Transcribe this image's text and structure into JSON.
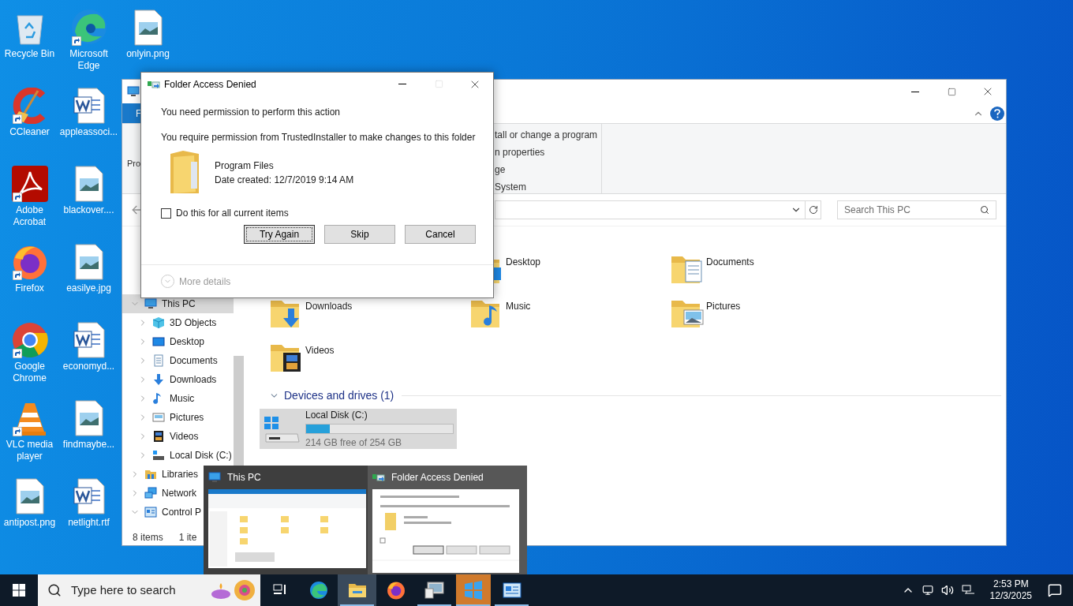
{
  "desktop": {
    "icons": [
      {
        "label": "Recycle Bin",
        "kind": "recycle",
        "shortcut": false
      },
      {
        "label": "CCleaner",
        "kind": "ccleaner",
        "shortcut": true
      },
      {
        "label": "Adobe Acrobat",
        "kind": "acrobat",
        "shortcut": true
      },
      {
        "label": "Firefox",
        "kind": "firefox",
        "shortcut": true
      },
      {
        "label": "Google Chrome",
        "kind": "chrome",
        "shortcut": true
      },
      {
        "label": "VLC media player",
        "kind": "vlc",
        "shortcut": true
      },
      {
        "label": "antipost.png",
        "kind": "image",
        "shortcut": false
      },
      {
        "label": "Microsoft Edge",
        "kind": "edge",
        "shortcut": true
      },
      {
        "label": "appleassoci...",
        "kind": "word",
        "shortcut": false
      },
      {
        "label": "blackover....",
        "kind": "image",
        "shortcut": false
      },
      {
        "label": "easilye.jpg",
        "kind": "image",
        "shortcut": false
      },
      {
        "label": "economyd...",
        "kind": "word",
        "shortcut": false
      },
      {
        "label": "findmaybe...",
        "kind": "image",
        "shortcut": false
      },
      {
        "label": "netlight.rtf",
        "kind": "word",
        "shortcut": false
      },
      {
        "label": "onlyin.png",
        "kind": "image",
        "shortcut": false
      }
    ]
  },
  "explorer": {
    "ribbon_tab": "F",
    "ribbon_fragment": "Pro",
    "ribbon_items": [
      "tall or change a program",
      "n properties",
      "ge",
      "System"
    ],
    "search": {
      "placeholder": "Search This PC"
    },
    "folders": [
      {
        "label": "Desktop",
        "kind": "desktop"
      },
      {
        "label": "Documents",
        "kind": "documents"
      },
      {
        "label": "Downloads",
        "kind": "downloads"
      },
      {
        "label": "Music",
        "kind": "music"
      },
      {
        "label": "Pictures",
        "kind": "pictures"
      },
      {
        "label": "Videos",
        "kind": "videos"
      }
    ],
    "section": {
      "label": "Devices and drives (1)",
      "expanded": true
    },
    "drive": {
      "name": "Local Disk (C:)",
      "level": 0.16,
      "reading": "214 GB free of 254 GB",
      "selected": true
    },
    "nav": [
      {
        "label": "This PC",
        "kind": "pc",
        "selected": true,
        "expanded": true,
        "children": [
          {
            "label": "3D Objects",
            "kind": "objects",
            "selected": false,
            "expanded": false
          },
          {
            "label": "Desktop",
            "kind": "desktop",
            "selected": false,
            "expanded": false
          },
          {
            "label": "Documents",
            "kind": "documents",
            "selected": false,
            "expanded": false
          },
          {
            "label": "Downloads",
            "kind": "downloads",
            "selected": false,
            "expanded": false
          },
          {
            "label": "Music",
            "kind": "music",
            "selected": false,
            "expanded": false
          },
          {
            "label": "Pictures",
            "kind": "pictures",
            "selected": false,
            "expanded": false
          },
          {
            "label": "Videos",
            "kind": "videos",
            "selected": false,
            "expanded": false
          },
          {
            "label": "Local Disk (C:)",
            "kind": "drive",
            "selected": false,
            "expanded": false
          }
        ]
      },
      {
        "label": "Libraries",
        "kind": "libraries",
        "selected": false,
        "expanded": false
      },
      {
        "label": "Network",
        "kind": "network",
        "selected": false,
        "expanded": false
      },
      {
        "label": "Control P",
        "kind": "control",
        "selected": false,
        "expanded": true
      }
    ],
    "status": [
      "8 items",
      "1 ite"
    ]
  },
  "dialog": {
    "title": "Folder Access Denied",
    "heading": "You need permission to perform this action",
    "message": "You require permission from TrustedInstaller to make changes to this folder",
    "item": {
      "name": "Program Files",
      "detail": "Date created: 12/7/2019 9:14 AM"
    },
    "checkbox": {
      "label": "Do this for all current items",
      "checked": false
    },
    "buttons": [
      {
        "label": "Try Again",
        "focused": true
      },
      {
        "label": "Skip",
        "focused": false
      },
      {
        "label": "Cancel",
        "focused": false
      }
    ],
    "more": "More details"
  },
  "switcher": [
    {
      "title": "This PC",
      "kind": "pc",
      "selected": false
    },
    {
      "title": "Folder Access Denied",
      "kind": "dialog",
      "selected": true
    }
  ],
  "taskbar": {
    "search_placeholder": "Type here to search",
    "apps": [
      {
        "kind": "taskview",
        "open": false,
        "selected": false
      },
      {
        "kind": "edge",
        "open": false,
        "selected": false
      },
      {
        "kind": "explorer",
        "open": true,
        "selected": true
      },
      {
        "kind": "firefox",
        "open": false,
        "selected": false
      },
      {
        "kind": "monitor",
        "open": true,
        "selected": false
      },
      {
        "kind": "tiles",
        "open": true,
        "selected": false
      },
      {
        "kind": "control",
        "open": true,
        "selected": false
      }
    ],
    "time": "2:53 PM",
    "date": "12/3/2025"
  }
}
